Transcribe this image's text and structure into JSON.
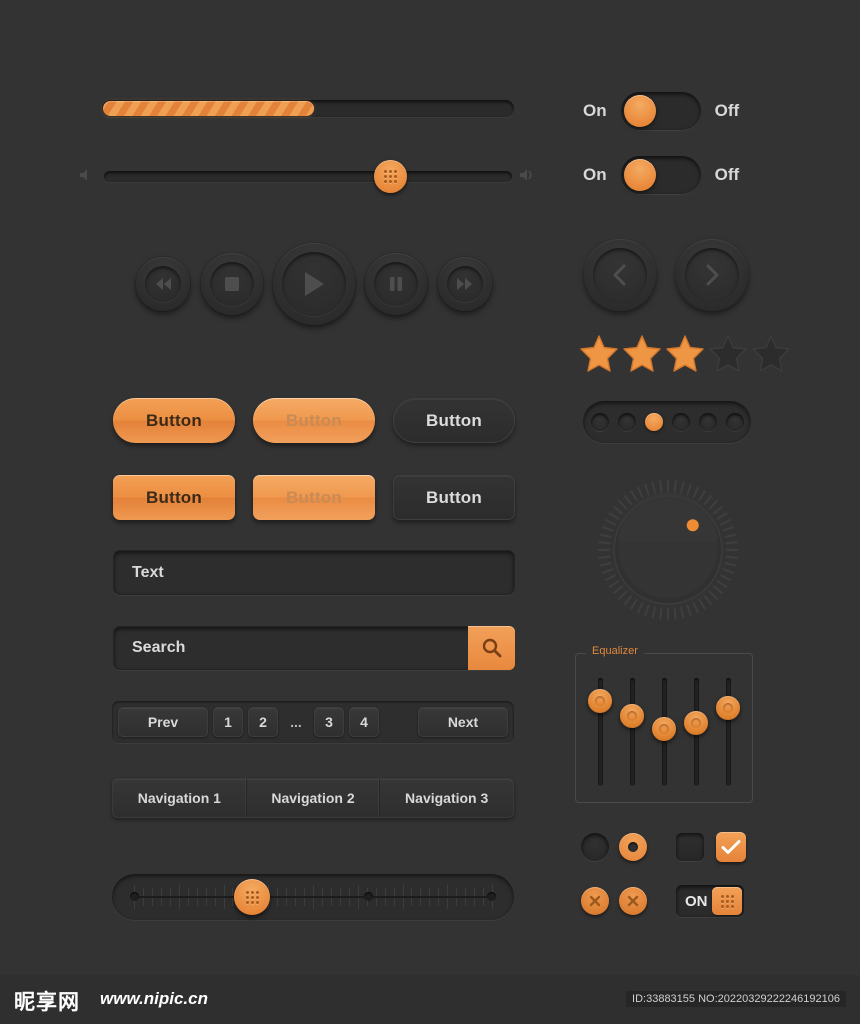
{
  "theme": {
    "background": "#333333",
    "accent": "#e8883a",
    "accent_light": "#f3a258",
    "text_light": "#dadada",
    "text_dark": "#3b2a18",
    "well": "#2b2b2b"
  },
  "progress": {
    "name": "progress-bar",
    "value_percent": 52,
    "fill_color": "#ef9645"
  },
  "volume_slider": {
    "value_percent": 70,
    "left_icon": "speaker-mute-icon",
    "right_icon": "speaker-volume-icon",
    "knob_icon": "grip-dots-icon"
  },
  "media_controls": [
    {
      "name": "rewind-button",
      "icon": "rewind-icon",
      "size": 54
    },
    {
      "name": "stop-button",
      "icon": "stop-icon",
      "size": 62
    },
    {
      "name": "play-button",
      "icon": "play-icon",
      "size": 82
    },
    {
      "name": "pause-button",
      "icon": "pause-icon",
      "size": 62
    },
    {
      "name": "forward-button",
      "icon": "forward-icon",
      "size": 54
    }
  ],
  "buttons": {
    "row1": [
      {
        "label": "Button",
        "style": "orange",
        "shape": "pill"
      },
      {
        "label": "Button",
        "style": "orange-muted",
        "shape": "pill"
      },
      {
        "label": "Button",
        "style": "dark",
        "shape": "pill"
      }
    ],
    "row2": [
      {
        "label": "Button",
        "style": "orange",
        "shape": "rounded"
      },
      {
        "label": "Button",
        "style": "orange-muted",
        "shape": "rounded"
      },
      {
        "label": "Button",
        "style": "dark",
        "shape": "rounded"
      }
    ]
  },
  "text_input": {
    "value": "Text",
    "placeholder": "Text"
  },
  "search_input": {
    "value": "Search",
    "placeholder": "Search",
    "button_icon": "search-icon"
  },
  "pagination": {
    "prev_label": "Prev",
    "next_label": "Next",
    "pages": [
      "1",
      "2",
      "…",
      "3",
      "4"
    ],
    "ellipsis": "..."
  },
  "nav_tabs": [
    {
      "label": "Navigation 1"
    },
    {
      "label": "Navigation 2"
    },
    {
      "label": "Navigation 3"
    }
  ],
  "ruler_slider": {
    "value_percent": 33,
    "marker_positions": [
      0,
      65,
      100
    ],
    "tick_count": 40,
    "knob_icon": "grip-dots-icon"
  },
  "toggles": [
    {
      "on_label": "On",
      "off_label": "Off",
      "state": "on"
    },
    {
      "on_label": "On",
      "off_label": "Off",
      "state": "on"
    }
  ],
  "arrow_buttons": [
    {
      "name": "prev-arrow-button",
      "icon": "chevron-left-icon"
    },
    {
      "name": "next-arrow-button",
      "icon": "chevron-right-icon"
    }
  ],
  "star_rating": {
    "value": 3,
    "max": 5,
    "filled_color": "#ef9645",
    "empty_color": "#2c2c2c"
  },
  "dot_pager": {
    "count": 6,
    "active_index": 2
  },
  "rotary_knob": {
    "indicator_angle_deg": 45,
    "tick_count": 56,
    "indicator_color": "#ef8c33"
  },
  "equalizer": {
    "legend": "Equalizer",
    "bands": [
      88,
      72,
      58,
      64,
      80
    ]
  },
  "form_controls": {
    "radio_off": {
      "name": "radio-unchecked",
      "checked": false
    },
    "radio_on": {
      "name": "radio-checked",
      "checked": true
    },
    "check_off": {
      "name": "checkbox-unchecked",
      "checked": false
    },
    "check_on": {
      "name": "checkbox-checked",
      "checked": true,
      "icon": "check-icon"
    },
    "close_buttons": [
      {
        "name": "close-button-1",
        "icon": "x-icon"
      },
      {
        "name": "close-button-2",
        "icon": "x-icon"
      }
    ],
    "on_switch": {
      "label": "ON",
      "handle_icon": "grip-dots-icon"
    }
  },
  "footer": {
    "logo": "昵享网",
    "url": "www.nipic.cn",
    "id_text": "ID:33883155 NO:20220329222246192106"
  }
}
